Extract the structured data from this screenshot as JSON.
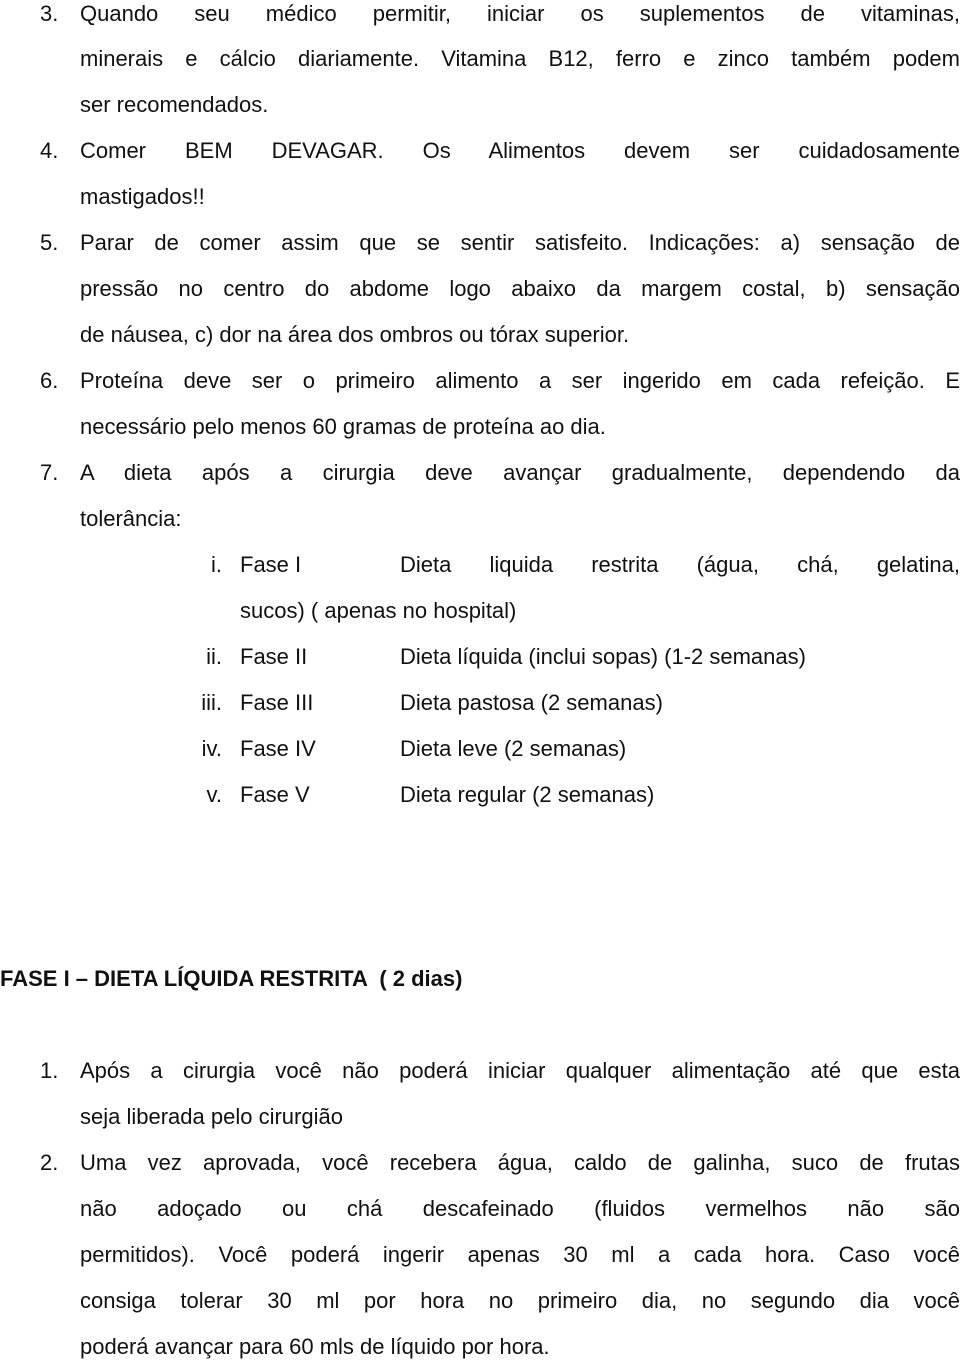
{
  "list_top": [
    {
      "number": "3.",
      "lines": [
        "Quando seu médico permitir, iniciar os suplementos de vitaminas,",
        "minerais e cálcio diariamente. Vitamina B12, ferro e zinco também podem",
        "ser recomendados."
      ]
    },
    {
      "number": "4.",
      "lines": [
        "Comer BEM DEVAGAR. Os Alimentos devem ser cuidadosamente",
        "mastigados!!"
      ]
    },
    {
      "number": "5.",
      "lines": [
        "Parar de comer assim que se sentir satisfeito. Indicações: a) sensação de",
        "pressão no centro do abdome logo abaixo da margem costal, b) sensação",
        "de náusea, c) dor na área dos ombros ou tórax superior."
      ]
    },
    {
      "number": "6.",
      "lines": [
        "Proteína deve ser o primeiro alimento a ser ingerido em cada refeição. E",
        "necessário pelo menos 60 gramas de proteína ao dia."
      ]
    },
    {
      "number": "7.",
      "lines": [
        "A dieta após a cirurgia deve avançar gradualmente, dependendo da",
        "tolerância:"
      ]
    }
  ],
  "phases": [
    {
      "roman": "i.",
      "phase": "Fase I",
      "description": "Dieta liquida restrita (água, chá, gelatina,",
      "continuation": "sucos) ( apenas no hospital)"
    },
    {
      "roman": "ii.",
      "phase": "Fase II",
      "description": "Dieta líquida (inclui sopas) (1-2 semanas)"
    },
    {
      "roman": "iii.",
      "phase": "Fase III",
      "description": "Dieta pastosa (2 semanas)"
    },
    {
      "roman": "iv.",
      "phase": "Fase IV",
      "description": "Dieta leve (2 semanas)"
    },
    {
      "roman": "v.",
      "phase": "Fase V",
      "description": "Dieta regular (2 semanas)"
    }
  ],
  "section_heading": "FASE I – DIETA LÍQUIDA RESTRITA  ( 2 dias)",
  "list_bottom": [
    {
      "number": "1.",
      "lines": [
        "Após a cirurgia você não poderá iniciar qualquer alimentação até que esta",
        "seja liberada pelo cirurgião"
      ]
    },
    {
      "number": "2.",
      "lines": [
        "Uma vez aprovada, você recebera água, caldo de galinha, suco de frutas",
        "não adoçado ou chá descafeinado (fluidos vermelhos não são",
        "permitidos). Você poderá ingerir apenas 30 ml a cada hora. Caso você",
        "consiga tolerar 30 ml por hora no primeiro dia, no segundo dia você",
        "poderá avançar para 60 mls de líquido por hora."
      ]
    }
  ]
}
